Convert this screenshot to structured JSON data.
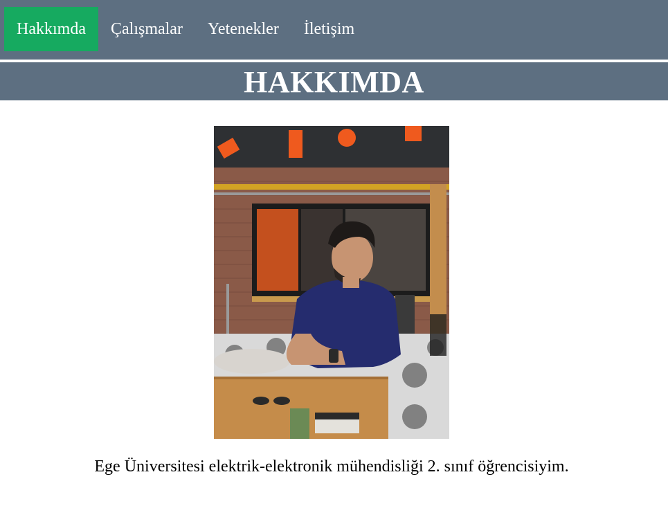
{
  "nav": {
    "items": [
      {
        "label": "Hakkımda",
        "active": true
      },
      {
        "label": "Çalışmalar",
        "active": false
      },
      {
        "label": "Yetenekler",
        "active": false
      },
      {
        "label": "İletişim",
        "active": false
      }
    ],
    "bg_color": "#5d6f81",
    "active_color": "#16aa60"
  },
  "banner": {
    "title": "HAKKIMDA"
  },
  "profile": {
    "bio": "Ege Üniversitesi elektrik-elektronik mühendisliği 2. sınıf öğrencisiyim."
  }
}
